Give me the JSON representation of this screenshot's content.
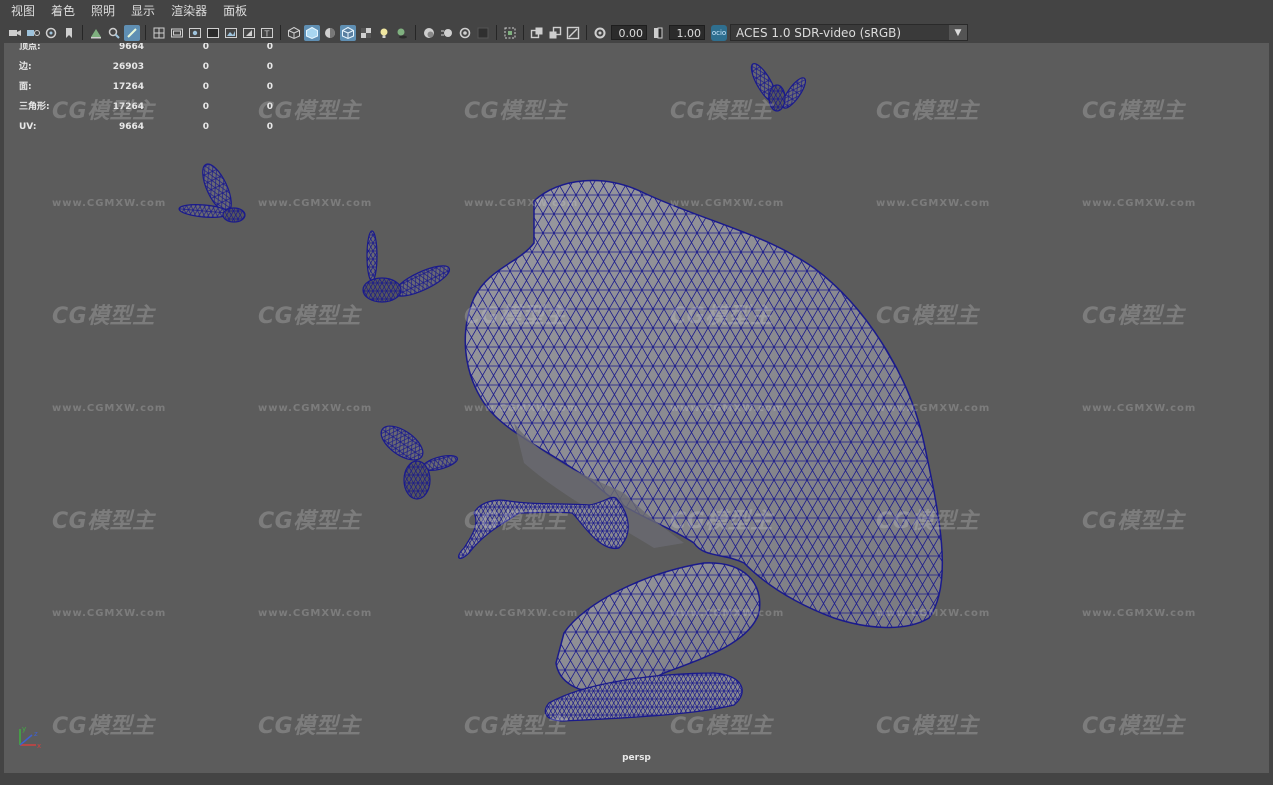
{
  "menu": [
    "视图",
    "着色",
    "照明",
    "显示",
    "渲染器",
    "面板"
  ],
  "toolbar": {
    "icons": [
      "camera-icon",
      "camera-attributes-icon",
      "bookmark-icon",
      "image-plane-icon",
      "grid-icon",
      "wireframe-icon",
      "shaded-icon",
      "textured-icon",
      "lights-icon",
      "shadows-icon",
      "isolate-icon",
      "xray-icon",
      "colorspace-icon"
    ],
    "exposure_value": "0.00",
    "gamma_value": "1.00",
    "colorspace": "ACES 1.0 SDR-video (sRGB)"
  },
  "hud": {
    "rows": [
      {
        "label": "顶点:",
        "v1": "9664",
        "v2": "0",
        "v3": "0"
      },
      {
        "label": "边:",
        "v1": "26903",
        "v2": "0",
        "v3": "0"
      },
      {
        "label": "面:",
        "v1": "17264",
        "v2": "0",
        "v3": "0"
      },
      {
        "label": "三角形:",
        "v1": "17264",
        "v2": "0",
        "v3": "0"
      },
      {
        "label": "UV:",
        "v1": "9664",
        "v2": "0",
        "v3": "0"
      }
    ]
  },
  "camera_label": "persp",
  "watermark": {
    "brand": "CG模型主",
    "url": "www.CGMXW.com"
  },
  "colors": {
    "wire": "#1a1a8c",
    "mesh_fill": "#8a8a90",
    "viewport_bg": "#5c5c5c",
    "active_icon": "#5f8fb3"
  }
}
